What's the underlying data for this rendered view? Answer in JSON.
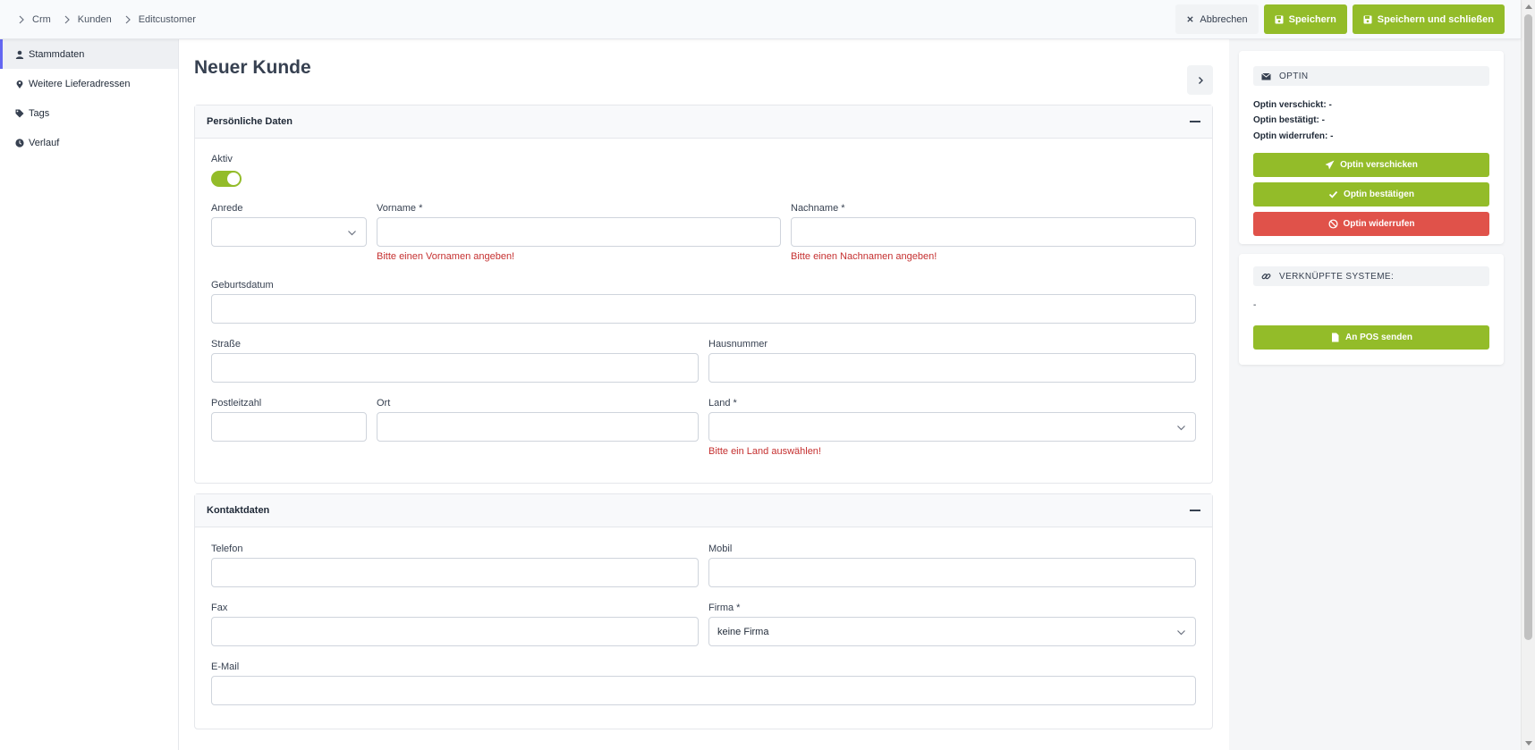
{
  "breadcrumb": [
    "Crm",
    "Kunden",
    "Editcustomer"
  ],
  "toolbar": {
    "cancel_label": "Abbrechen",
    "save_label": "Speichern",
    "save_close_label": "Speichern und schließen"
  },
  "sidebar": {
    "items": [
      {
        "label": "Stammdaten",
        "icon": "user-icon",
        "active": true
      },
      {
        "label": "Weitere Lieferadressen",
        "icon": "map-marker-icon",
        "active": false
      },
      {
        "label": "Tags",
        "icon": "tags-icon",
        "active": false
      },
      {
        "label": "Verlauf",
        "icon": "clock-icon",
        "active": false
      }
    ]
  },
  "page": {
    "title": "Neuer Kunde"
  },
  "personal": {
    "title": "Persönliche Daten",
    "aktiv_label": "Aktiv",
    "anrede_label": "Anrede",
    "vorname_label": "Vorname *",
    "vorname_error": "Bitte einen Vornamen angeben!",
    "nachname_label": "Nachname *",
    "nachname_error": "Bitte einen Nachnamen angeben!",
    "geburtsdatum_label": "Geburtsdatum",
    "strasse_label": "Straße",
    "hausnummer_label": "Hausnummer",
    "plz_label": "Postleitzahl",
    "ort_label": "Ort",
    "land_label": "Land *",
    "land_error": "Bitte ein Land auswählen!"
  },
  "contact": {
    "title": "Kontaktdaten",
    "telefon_label": "Telefon",
    "mobil_label": "Mobil",
    "fax_label": "Fax",
    "firma_label": "Firma *",
    "firma_value": "keine Firma",
    "email_label": "E-Mail"
  },
  "optin": {
    "title": "OPTIN",
    "sent": "Optin verschickt: -",
    "confirmed": "Optin bestätigt: -",
    "revoked": "Optin widerrufen: -",
    "send_label": "Optin verschicken",
    "confirm_label": "Optin bestätigen",
    "revoke_label": "Optin widerrufen"
  },
  "linked": {
    "title": "VERKNÜPFTE SYSTEME:",
    "value": "-",
    "pos_label": "An POS senden"
  },
  "colors": {
    "accent_green": "#93bc29",
    "danger_red": "#e0524a",
    "error_text": "#c53030"
  }
}
